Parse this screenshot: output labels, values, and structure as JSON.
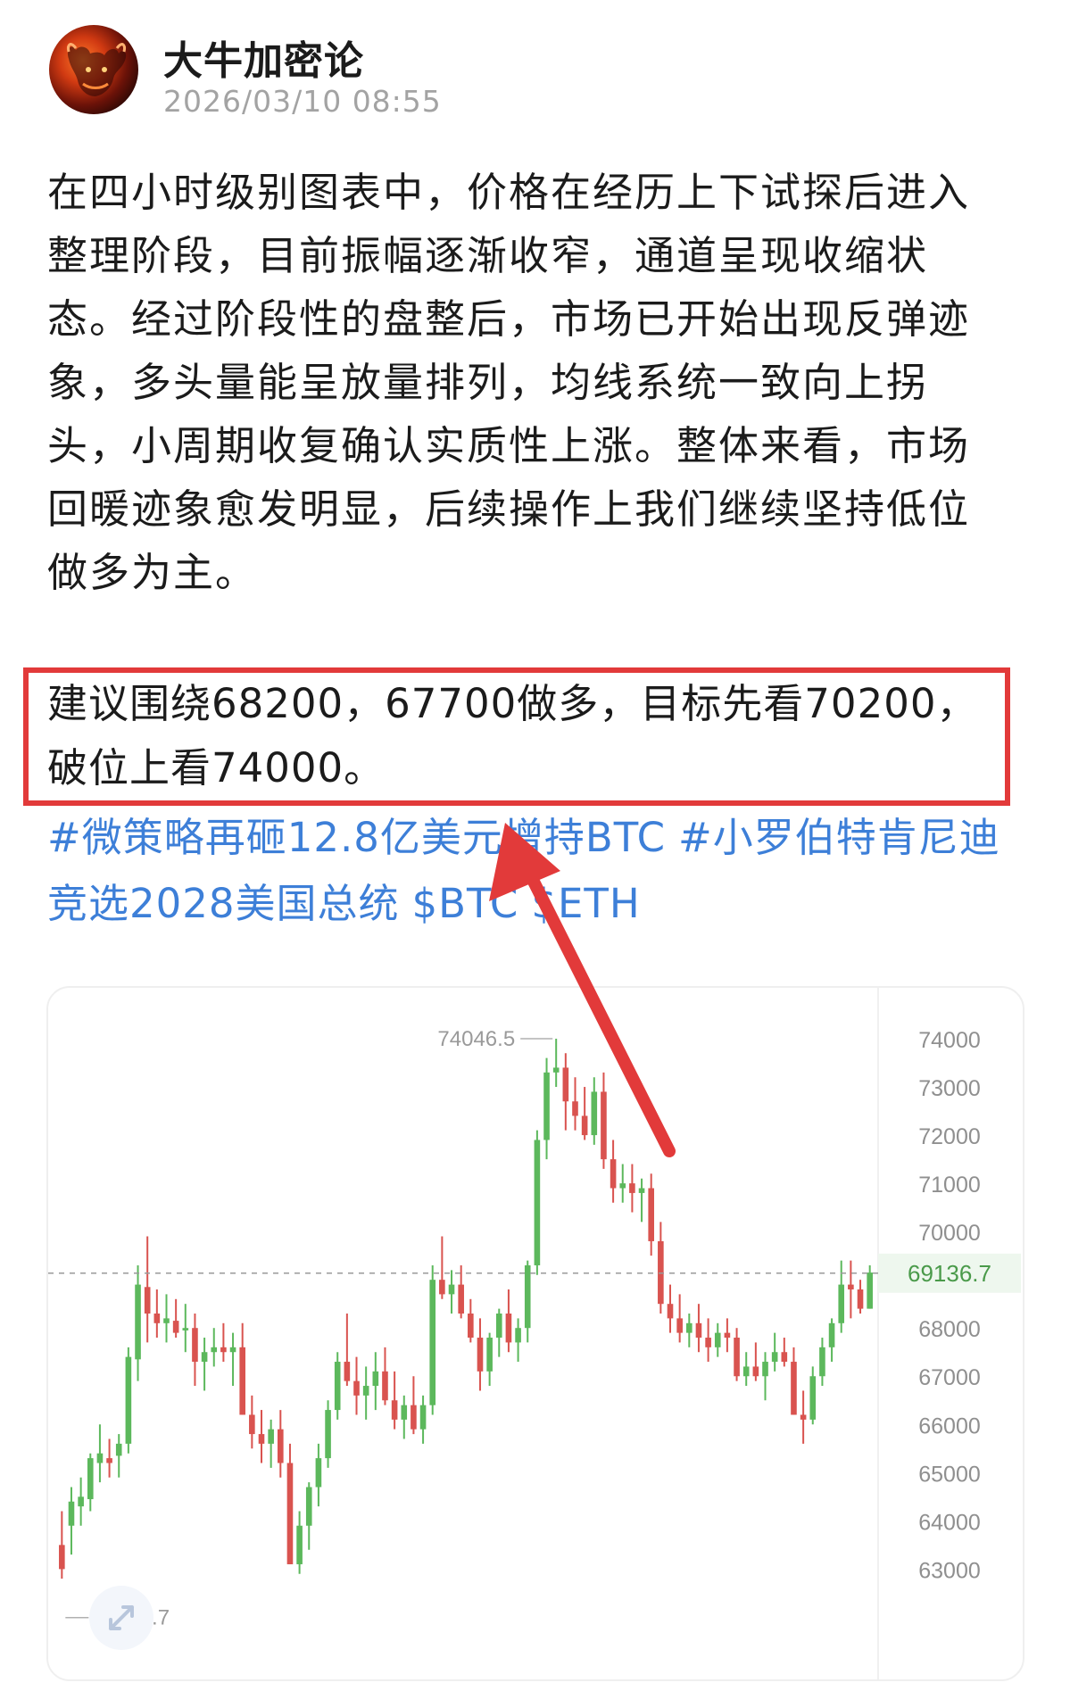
{
  "post": {
    "author": "大牛加密论",
    "time": "2026/03/10 08:55",
    "body_lines": [
      "在四小时级别图表中，价格在经历上下试探后进入",
      "整理阶段，目前振幅逐渐收窄，通道呈现收缩状",
      "态。经过阶段性的盘整后，市场已开始出现反弹迹",
      "象，多头量能呈放量排列，均线系统一致向上拐",
      "头，小周期收复确认实质性上涨。整体来看，市场",
      "回暖迹象愈发明显，后续操作上我们继续坚持低位",
      "做多为主。"
    ],
    "recommendation_lines": [
      "建议围绕68200，67700做多，目标先看70200，",
      "破位上看74000。"
    ],
    "tags": [
      "#微策略再砸12.8亿美元增持BTC",
      "#小罗伯特肯尼迪竞选2028美国总统",
      "$BTC",
      "$ETH"
    ]
  },
  "colors": {
    "up": "#5cb85c",
    "down": "#d9534f",
    "highlight_box": "#e23a3a",
    "arrow": "#e23a3a",
    "tag": "#3d7fd8",
    "current_price_label": "#4a9a4a"
  },
  "chart_data": {
    "type": "candlestick",
    "y_ticks": [
      74000,
      73000,
      72000,
      71000,
      70000,
      69000,
      68000,
      67000,
      66000,
      65000,
      64000,
      63000
    ],
    "ylim": [
      62100,
      74500
    ],
    "max_label": "74046.5",
    "min_label": "62401.7",
    "current_price": "69136.7",
    "current_value": 69136.7,
    "candles": [
      [
        63500,
        64200,
        62800,
        63000
      ],
      [
        63900,
        64700,
        63300,
        64400
      ],
      [
        64300,
        64900,
        63900,
        64500
      ],
      [
        64450,
        65400,
        64200,
        65300
      ],
      [
        65200,
        66000,
        64800,
        65400
      ],
      [
        65300,
        65700,
        64900,
        65200
      ],
      [
        65350,
        65800,
        64900,
        65600
      ],
      [
        65600,
        67600,
        65400,
        67400
      ],
      [
        67350,
        69300,
        66900,
        68900
      ],
      [
        68850,
        69900,
        67700,
        68300
      ],
      [
        68300,
        68800,
        67800,
        68100
      ],
      [
        68100,
        68700,
        67700,
        68200
      ],
      [
        68150,
        68600,
        67800,
        67900
      ],
      [
        67950,
        68500,
        67500,
        68000
      ],
      [
        68000,
        68300,
        66800,
        67300
      ],
      [
        67300,
        67800,
        66700,
        67500
      ],
      [
        67500,
        68000,
        67200,
        67600
      ],
      [
        67600,
        68100,
        67300,
        67500
      ],
      [
        67500,
        67900,
        66800,
        67600
      ],
      [
        67600,
        68100,
        66200,
        66200
      ],
      [
        66200,
        66600,
        65500,
        65800
      ],
      [
        65800,
        66300,
        65200,
        65600
      ],
      [
        65600,
        66100,
        65100,
        65900
      ],
      [
        65900,
        66300,
        64900,
        65200
      ],
      [
        65200,
        65600,
        63100,
        63100
      ],
      [
        63100,
        64200,
        62900,
        63900
      ],
      [
        63900,
        64800,
        63400,
        64700
      ],
      [
        64700,
        65600,
        64300,
        65300
      ],
      [
        65300,
        66500,
        65100,
        66300
      ],
      [
        66300,
        67500,
        66100,
        67300
      ],
      [
        67300,
        68300,
        66800,
        66900
      ],
      [
        66900,
        67400,
        66200,
        66600
      ],
      [
        66600,
        67200,
        66100,
        66800
      ],
      [
        66800,
        67500,
        66300,
        67100
      ],
      [
        67100,
        67600,
        66400,
        66500
      ],
      [
        66500,
        67100,
        65900,
        66100
      ],
      [
        66100,
        66600,
        65700,
        66400
      ],
      [
        66400,
        67000,
        65800,
        65900
      ],
      [
        65900,
        66600,
        65600,
        66400
      ],
      [
        66400,
        69300,
        66200,
        69000
      ],
      [
        69000,
        69900,
        68600,
        68700
      ],
      [
        68700,
        69200,
        68300,
        68900
      ],
      [
        68900,
        69300,
        68200,
        68300
      ],
      [
        68300,
        68600,
        67700,
        67800
      ],
      [
        67800,
        68200,
        66700,
        67100
      ],
      [
        67100,
        67900,
        66800,
        67800
      ],
      [
        67800,
        68400,
        67400,
        68300
      ],
      [
        68300,
        68800,
        67500,
        67700
      ],
      [
        67700,
        68200,
        67300,
        68000
      ],
      [
        68000,
        69400,
        67700,
        69300
      ],
      [
        69300,
        72100,
        69100,
        71900
      ],
      [
        71900,
        73600,
        71500,
        73300
      ],
      [
        73300,
        74000,
        73000,
        73400
      ],
      [
        73400,
        73700,
        72100,
        72700
      ],
      [
        72700,
        73200,
        72100,
        72400
      ],
      [
        72400,
        73000,
        71900,
        72000
      ],
      [
        72000,
        73200,
        71800,
        72900
      ],
      [
        72900,
        73300,
        71300,
        71500
      ],
      [
        71500,
        71900,
        70600,
        70900
      ],
      [
        70900,
        71400,
        70600,
        71000
      ],
      [
        71000,
        71400,
        70400,
        70800
      ],
      [
        70800,
        71100,
        70200,
        70900
      ],
      [
        70900,
        71200,
        69500,
        69800
      ],
      [
        69800,
        70200,
        68300,
        68500
      ],
      [
        68500,
        68900,
        67900,
        68200
      ],
      [
        68200,
        68700,
        67700,
        67900
      ],
      [
        67900,
        68300,
        67600,
        68100
      ],
      [
        68100,
        68500,
        67500,
        67800
      ],
      [
        67800,
        68200,
        67300,
        67600
      ],
      [
        67600,
        68100,
        67400,
        67900
      ],
      [
        67900,
        68200,
        67500,
        67800
      ],
      [
        67800,
        68000,
        66900,
        67000
      ],
      [
        67000,
        67500,
        66800,
        67200
      ],
      [
        67200,
        67700,
        66900,
        67000
      ],
      [
        67000,
        67500,
        66500,
        67300
      ],
      [
        67300,
        67900,
        67100,
        67500
      ],
      [
        67500,
        67800,
        67200,
        67300
      ],
      [
        67300,
        67600,
        66200,
        66200
      ],
      [
        66200,
        66700,
        65600,
        66100
      ],
      [
        66100,
        67200,
        66000,
        67000
      ],
      [
        67000,
        67800,
        66800,
        67600
      ],
      [
        67600,
        68200,
        67300,
        68100
      ],
      [
        68100,
        69400,
        67900,
        68900
      ],
      [
        68900,
        69400,
        68200,
        68800
      ],
      [
        68800,
        69000,
        68300,
        68400
      ],
      [
        68400,
        69300,
        68400,
        69150
      ]
    ]
  }
}
